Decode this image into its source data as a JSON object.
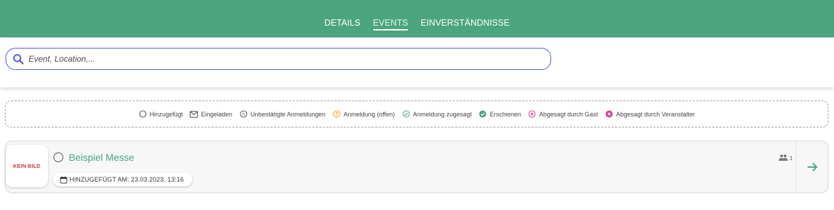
{
  "tabs": [
    {
      "label": "DETAILS"
    },
    {
      "label": "EVENTS",
      "active": true
    },
    {
      "label": "EINVERSTÄNDNISSE"
    }
  ],
  "search": {
    "placeholder": "Event, Location,..."
  },
  "legend": [
    {
      "icon": "circle-outline-icon",
      "label": "Hinzugefügt"
    },
    {
      "icon": "envelope-icon",
      "label": "Eingeladen"
    },
    {
      "icon": "unconfirmed-icon",
      "label": "Unbestätigte Anmeldungen"
    },
    {
      "icon": "question-circle-icon",
      "label": "Anmeldung (offen)"
    },
    {
      "icon": "check-circle-outline-icon",
      "label": "Anmeldung zugesagt"
    },
    {
      "icon": "check-circle-filled-icon",
      "label": "Erschienen"
    },
    {
      "icon": "x-circle-outline-icon",
      "label": "Abgesagt durch Gast"
    },
    {
      "icon": "x-circle-filled-icon",
      "label": "Abgesagt durch Veranstalter"
    }
  ],
  "event": {
    "thumbnail_text": "KEIN BILD",
    "title": "Beispiel Messe",
    "added_label": "HINZUGEFÜGT AM: 23.03.2023, 13:16",
    "guest_count": "1"
  },
  "colors": {
    "brand_green": "#4ba57f",
    "search_border": "#4f5fd0",
    "thumb_text": "#d32f2f",
    "pending_orange": "#f0a020",
    "accent_pink": "#e0368f"
  }
}
